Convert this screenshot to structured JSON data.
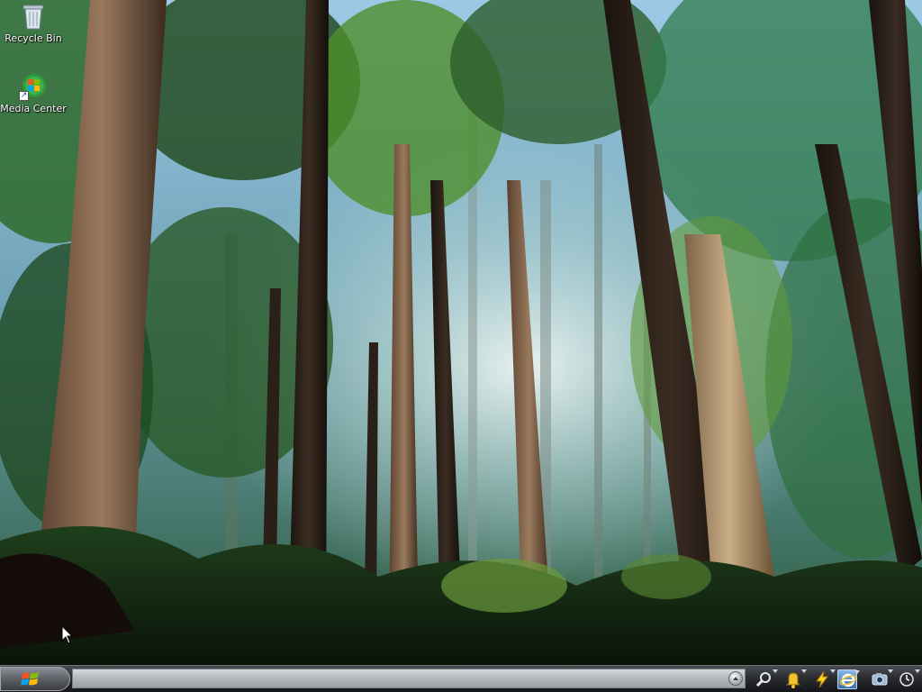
{
  "desktop": {
    "icons": [
      {
        "label": "Recycle Bin",
        "icon": "recycle-bin-icon"
      },
      {
        "label": "Media Center",
        "icon": "media-center-icon"
      }
    ]
  },
  "taskbar": {
    "start_icon": "windows-logo-icon",
    "tray_icons": [
      "search-icon",
      "bell-icon",
      "lightning-icon",
      "internet-explorer-icon",
      "camera-icon",
      "clock-icon"
    ]
  },
  "colors": {
    "taskbar": "#2b2d31",
    "band": "#b3b6bb",
    "desktop_text": "#ffffff"
  }
}
